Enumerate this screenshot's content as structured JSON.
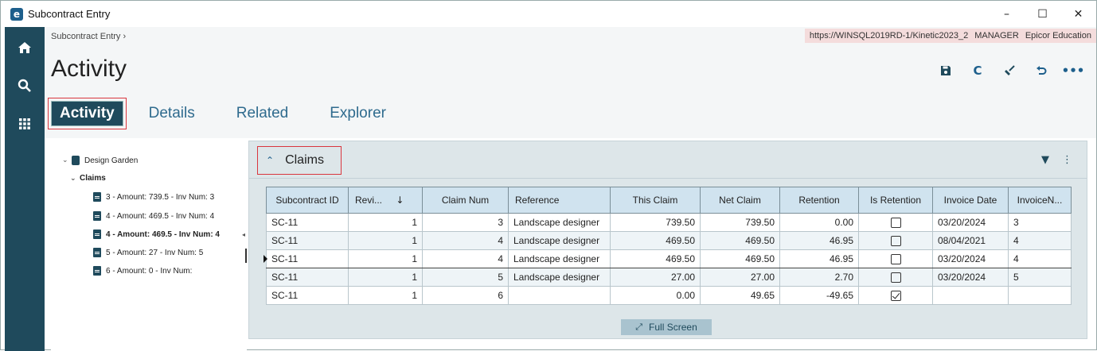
{
  "window": {
    "title": "Subcontract Entry",
    "controls": {
      "minimize": "–",
      "maximize": "☐",
      "close": "✕"
    }
  },
  "sidebar": {
    "icons": [
      "home-icon",
      "search-icon",
      "grid-icon"
    ]
  },
  "header": {
    "breadcrumb": "Subcontract Entry ›",
    "server": "https://WINSQL2019RD-1/Kinetic2023_2",
    "user": "MANAGER",
    "company": "Epicor Education",
    "page_title": "Activity",
    "toolbar": [
      "save-icon",
      "refresh-icon",
      "clear-icon",
      "undo-icon",
      "more-icon"
    ]
  },
  "tabs": [
    {
      "label": "Activity",
      "active": true
    },
    {
      "label": "Details"
    },
    {
      "label": "Related"
    },
    {
      "label": "Explorer"
    }
  ],
  "tree": {
    "root": "Design Garden",
    "group": "Claims",
    "items": [
      "3 - Amount: 739.5 - Inv Num: 3",
      "4 - Amount: 469.5 - Inv Num: 4",
      "4 - Amount: 469.5 - Inv Num: 4",
      "5 - Amount: 27 - Inv Num: 5",
      "6 - Amount: 0 - Inv Num:"
    ]
  },
  "panel": {
    "title": "Claims",
    "fullscreen_label": "Full Screen",
    "columns": [
      "Subcontract ID",
      "Revi...",
      "Claim Num",
      "Reference",
      "This Claim",
      "Net Claim",
      "Retention",
      "Is Retention",
      "Invoice Date",
      "InvoiceN..."
    ],
    "rows": [
      {
        "id": "SC-11",
        "rev": "1",
        "claim": "3",
        "ref": "Landscape designer",
        "this": "739.50",
        "net": "739.50",
        "ret": "0.00",
        "isret": false,
        "date": "03/20/2024",
        "inv": "3"
      },
      {
        "id": "SC-11",
        "rev": "1",
        "claim": "4",
        "ref": "Landscape designer",
        "this": "469.50",
        "net": "469.50",
        "ret": "46.95",
        "isret": false,
        "date": "08/04/2021",
        "inv": "4"
      },
      {
        "id": "SC-11",
        "rev": "1",
        "claim": "4",
        "ref": "Landscape designer",
        "this": "469.50",
        "net": "469.50",
        "ret": "46.95",
        "isret": false,
        "date": "03/20/2024",
        "inv": "4"
      },
      {
        "id": "SC-11",
        "rev": "1",
        "claim": "5",
        "ref": "Landscape designer",
        "this": "27.00",
        "net": "27.00",
        "ret": "2.70",
        "isret": false,
        "date": "03/20/2024",
        "inv": "5"
      },
      {
        "id": "SC-11",
        "rev": "1",
        "claim": "6",
        "ref": "",
        "this": "0.00",
        "net": "49.65",
        "ret": "-49.65",
        "isret": true,
        "date": "",
        "inv": ""
      }
    ]
  },
  "colors": {
    "sidebar": "#1f4a5c",
    "accent": "#1d5f8c",
    "highlight": "#d9363e"
  }
}
